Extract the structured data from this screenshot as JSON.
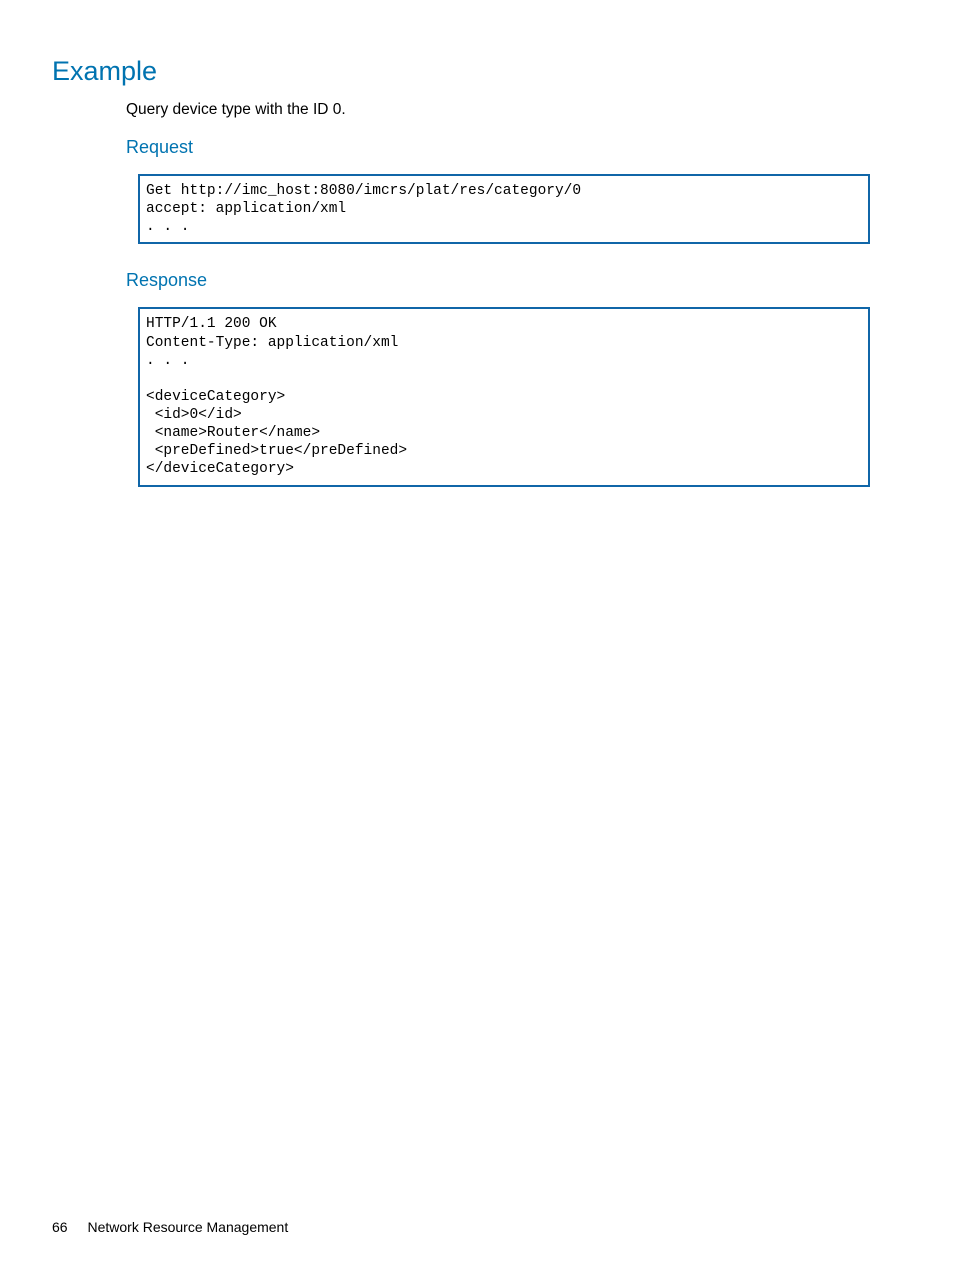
{
  "heading1": "Example",
  "bodyText": "Query device type with the ID 0.",
  "request": {
    "heading": "Request",
    "code": "Get http://imc_host:8080/imcrs/plat/res/category/0\naccept: application/xml\n. . ."
  },
  "response": {
    "heading": "Response",
    "code": "HTTP/1.1 200 OK\nContent-Type: application/xml\n. . .\n\n<deviceCategory>\n <id>0</id>\n <name>Router</name>\n <preDefined>true</preDefined>\n</deviceCategory>"
  },
  "footer": {
    "pageNumber": "66",
    "sectionTitle": "Network Resource Management"
  }
}
